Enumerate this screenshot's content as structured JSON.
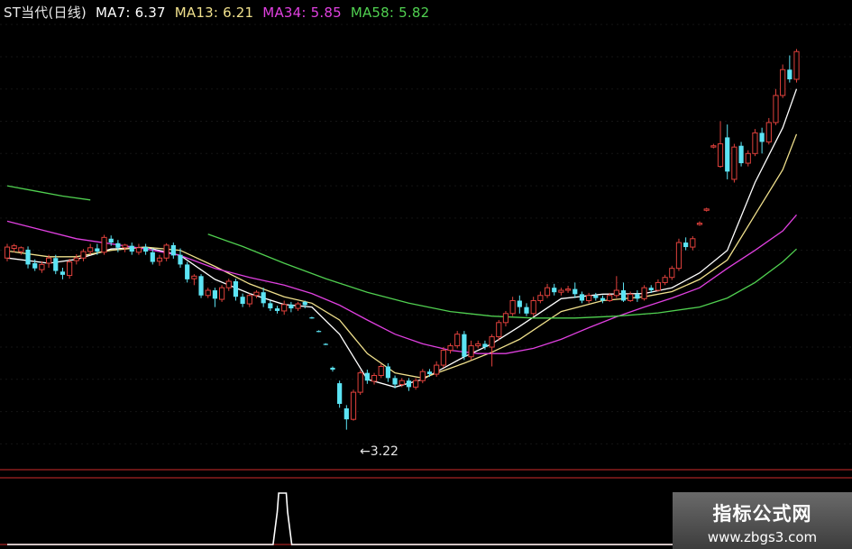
{
  "header": {
    "stock_label": "ST当代(日线)",
    "ma7_text": "MA7: 6.37",
    "ma13_text": "MA13: 6.21",
    "ma34_text": "MA34: 5.85",
    "ma58_text": "MA58: 5.82"
  },
  "annotation": {
    "low_label": "←3.22"
  },
  "watermark": {
    "title": "指标公式网",
    "url": "www.zbgs3.com"
  },
  "colors": {
    "background": "#000000",
    "up": "#e0413c",
    "down": "#5ce4f4",
    "ma7": "#ffffff",
    "ma13": "#f0e08c",
    "ma34": "#e040e0",
    "ma58": "#50d050",
    "axis": "#8b1d1d",
    "indicator": "#ffffff"
  },
  "chart_data": [
    {
      "type": "candlestick",
      "title": "ST当代(日线)",
      "ylim": [
        2.6,
        9.6
      ],
      "low_marker": 3.22,
      "candles": [
        [
          5.88,
          6.05,
          6.1,
          5.83
        ],
        [
          6.03,
          6.07,
          6.1,
          5.97
        ],
        [
          5.98,
          6.04,
          6.06,
          5.93
        ],
        [
          6.01,
          5.78,
          6.06,
          5.72
        ],
        [
          5.8,
          5.72,
          5.86,
          5.68
        ],
        [
          5.7,
          5.78,
          5.83,
          5.65
        ],
        [
          5.8,
          5.88,
          5.93,
          5.73
        ],
        [
          5.88,
          5.68,
          5.93,
          5.63
        ],
        [
          5.67,
          5.62,
          5.73,
          5.55
        ],
        [
          5.61,
          5.82,
          5.87,
          5.56
        ],
        [
          5.84,
          5.88,
          5.94,
          5.78
        ],
        [
          5.88,
          5.98,
          6.02,
          5.83
        ],
        [
          5.98,
          6.04,
          6.1,
          5.93
        ],
        [
          6.03,
          5.98,
          6.1,
          5.93
        ],
        [
          5.97,
          6.2,
          6.24,
          5.93
        ],
        [
          6.18,
          6.12,
          6.23,
          6.07
        ],
        [
          6.11,
          6.04,
          6.16,
          5.97
        ],
        [
          6.04,
          6.08,
          6.1,
          5.97
        ],
        [
          6.07,
          5.98,
          6.12,
          5.93
        ],
        [
          5.97,
          6.04,
          6.1,
          5.93
        ],
        [
          6.05,
          5.98,
          6.1,
          5.93
        ],
        [
          5.97,
          5.82,
          6.03,
          5.78
        ],
        [
          5.83,
          5.88,
          5.93,
          5.76
        ],
        [
          5.88,
          6.08,
          6.11,
          5.83
        ],
        [
          6.08,
          5.92,
          6.12,
          5.87
        ],
        [
          5.93,
          5.78,
          6.03,
          5.73
        ],
        [
          5.78,
          5.55,
          5.82,
          5.5
        ],
        [
          5.56,
          5.6,
          5.63,
          5.46
        ],
        [
          5.6,
          5.3,
          5.63,
          5.26
        ],
        [
          5.3,
          5.38,
          5.42,
          5.26
        ],
        [
          5.38,
          5.25,
          5.42,
          5.12
        ],
        [
          5.24,
          5.42,
          5.46,
          5.2
        ],
        [
          5.42,
          5.52,
          5.56,
          5.37
        ],
        [
          5.52,
          5.28,
          5.56,
          5.22
        ],
        [
          5.28,
          5.17,
          5.33,
          5.12
        ],
        [
          5.17,
          5.3,
          5.33,
          5.12
        ],
        [
          5.3,
          5.35,
          5.38,
          5.26
        ],
        [
          5.35,
          5.18,
          5.42,
          5.12
        ],
        [
          5.18,
          5.1,
          5.22,
          5.06
        ],
        [
          5.1,
          5.06,
          5.14,
          5.02
        ],
        [
          5.06,
          5.16,
          5.22,
          5.0
        ],
        [
          5.16,
          5.1,
          5.2,
          5.04
        ],
        [
          5.1,
          5.17,
          5.2,
          5.06
        ],
        [
          5.2,
          5.15,
          5.22,
          5.1
        ],
        [
          4.96,
          4.95,
          4.97,
          4.94
        ],
        [
          4.75,
          4.74,
          4.76,
          4.73
        ],
        [
          4.55,
          4.54,
          4.56,
          4.53
        ],
        [
          4.18,
          4.15,
          4.2,
          4.12
        ],
        [
          3.94,
          3.62,
          3.98,
          3.56
        ],
        [
          3.55,
          3.38,
          3.6,
          3.22
        ],
        [
          3.38,
          3.8,
          3.84,
          3.36
        ],
        [
          3.8,
          4.1,
          4.14,
          3.76
        ],
        [
          4.1,
          3.98,
          4.15,
          3.93
        ],
        [
          3.97,
          4.06,
          4.1,
          3.92
        ],
        [
          4.06,
          4.2,
          4.24,
          4.02
        ],
        [
          4.2,
          4.02,
          4.25,
          3.96
        ],
        [
          4.02,
          3.92,
          4.06,
          3.86
        ],
        [
          3.92,
          3.98,
          4.02,
          3.88
        ],
        [
          3.98,
          3.88,
          4.02,
          3.82
        ],
        [
          3.88,
          3.98,
          4.02,
          3.84
        ],
        [
          3.98,
          4.12,
          4.16,
          3.94
        ],
        [
          4.12,
          4.08,
          4.16,
          4.04
        ],
        [
          4.08,
          4.22,
          4.28,
          4.04
        ],
        [
          4.22,
          4.45,
          4.5,
          4.18
        ],
        [
          4.45,
          4.52,
          4.56,
          4.4
        ],
        [
          4.52,
          4.7,
          4.75,
          4.48
        ],
        [
          4.7,
          4.35,
          4.75,
          4.3
        ],
        [
          4.35,
          4.52,
          4.6,
          4.3
        ],
        [
          4.52,
          4.55,
          4.6,
          4.48
        ],
        [
          4.55,
          4.5,
          4.6,
          4.46
        ],
        [
          4.5,
          4.66,
          4.7,
          4.2
        ],
        [
          4.66,
          4.88,
          4.92,
          4.6
        ],
        [
          4.88,
          5.02,
          5.06,
          4.82
        ],
        [
          5.02,
          5.22,
          5.28,
          4.98
        ],
        [
          5.22,
          5.12,
          5.3,
          5.02
        ],
        [
          5.12,
          5.02,
          5.18,
          4.98
        ],
        [
          5.02,
          5.22,
          5.28,
          4.98
        ],
        [
          5.22,
          5.3,
          5.36,
          5.18
        ],
        [
          5.3,
          5.42,
          5.48,
          5.26
        ],
        [
          5.42,
          5.35,
          5.48,
          5.3
        ],
        [
          5.35,
          5.38,
          5.42,
          5.3
        ],
        [
          5.38,
          5.4,
          5.45,
          5.34
        ],
        [
          5.4,
          5.32,
          5.5,
          5.26
        ],
        [
          5.32,
          5.22,
          5.36,
          5.18
        ],
        [
          5.22,
          5.3,
          5.34,
          5.18
        ],
        [
          5.3,
          5.26,
          5.34,
          5.22
        ],
        [
          5.26,
          5.22,
          5.3,
          5.18
        ],
        [
          5.22,
          5.3,
          5.34,
          5.2
        ],
        [
          5.3,
          5.38,
          5.6,
          5.26
        ],
        [
          5.38,
          5.22,
          5.5,
          5.2
        ],
        [
          5.22,
          5.32,
          5.36,
          5.2
        ],
        [
          5.32,
          5.25,
          5.38,
          5.2
        ],
        [
          5.25,
          5.42,
          5.46,
          5.22
        ],
        [
          5.42,
          5.38,
          5.46,
          5.34
        ],
        [
          5.38,
          5.5,
          5.55,
          5.36
        ],
        [
          5.5,
          5.58,
          5.62,
          5.46
        ],
        [
          5.58,
          5.72,
          5.76,
          5.54
        ],
        [
          5.72,
          6.12,
          6.18,
          5.68
        ],
        [
          6.12,
          6.05,
          6.2,
          6.0
        ],
        [
          6.05,
          6.18,
          6.22,
          6.0
        ],
        [
          6.4,
          6.42,
          6.45,
          6.38
        ],
        [
          6.62,
          6.64,
          6.66,
          6.6
        ],
        [
          7.6,
          7.62,
          7.65,
          7.58
        ],
        [
          7.3,
          7.65,
          8.0,
          7.28
        ],
        [
          7.75,
          7.22,
          7.95,
          7.1
        ],
        [
          7.1,
          7.6,
          7.65,
          7.05
        ],
        [
          7.62,
          7.35,
          7.68,
          7.3
        ],
        [
          7.35,
          7.5,
          7.55,
          7.3
        ],
        [
          7.5,
          7.82,
          7.88,
          7.46
        ],
        [
          7.82,
          7.68,
          7.9,
          7.5
        ],
        [
          7.68,
          7.98,
          8.05,
          7.64
        ],
        [
          7.98,
          8.4,
          8.5,
          7.94
        ],
        [
          8.4,
          8.8,
          8.88,
          8.36
        ],
        [
          8.8,
          8.65,
          9.02,
          8.6
        ],
        [
          8.65,
          9.08,
          9.12,
          8.6
        ]
      ]
    },
    {
      "type": "line",
      "title": "ST当代(日线)",
      "ylim": [
        2.6,
        9.6
      ],
      "series": [
        {
          "name": "MA7",
          "color": "#ffffff",
          "x": [
            0,
            6,
            10,
            15,
            20,
            25,
            30,
            35,
            40,
            44,
            48,
            52,
            56,
            60,
            66,
            70,
            74,
            80,
            86,
            92,
            96,
            100,
            104,
            108,
            112,
            114
          ],
          "values": [
            5.88,
            5.8,
            5.86,
            6.02,
            6.05,
            5.92,
            5.55,
            5.33,
            5.16,
            5.12,
            4.7,
            4.0,
            3.88,
            4.0,
            4.35,
            4.55,
            4.82,
            5.25,
            5.32,
            5.33,
            5.42,
            5.65,
            6.0,
            7.05,
            7.9,
            8.5
          ]
        },
        {
          "name": "MA13",
          "color": "#f0e08c",
          "x": [
            0,
            6,
            10,
            15,
            20,
            25,
            30,
            35,
            40,
            44,
            48,
            52,
            56,
            60,
            66,
            70,
            74,
            80,
            86,
            92,
            96,
            100,
            104,
            108,
            112,
            114
          ],
          "values": [
            5.99,
            5.9,
            5.9,
            6.0,
            6.05,
            6.0,
            5.75,
            5.48,
            5.28,
            5.18,
            4.92,
            4.4,
            4.1,
            4.02,
            4.25,
            4.42,
            4.62,
            5.05,
            5.22,
            5.28,
            5.36,
            5.55,
            5.85,
            6.55,
            7.25,
            7.8
          ]
        },
        {
          "name": "MA34",
          "color": "#e040e0",
          "x": [
            0,
            10,
            20,
            25,
            30,
            35,
            40,
            44,
            48,
            52,
            56,
            60,
            64,
            68,
            72,
            76,
            80,
            84,
            88,
            92,
            96,
            100,
            104,
            108,
            112,
            114
          ],
          "values": [
            6.45,
            6.18,
            6.02,
            5.92,
            5.72,
            5.58,
            5.46,
            5.33,
            5.15,
            4.92,
            4.7,
            4.55,
            4.45,
            4.4,
            4.4,
            4.48,
            4.62,
            4.8,
            4.97,
            5.12,
            5.26,
            5.42,
            5.72,
            6.0,
            6.3,
            6.55
          ]
        },
        {
          "name": "MA58",
          "color": "#50d050",
          "x": [
            0,
            4,
            8,
            12
          ],
          "values": [
            7.0,
            6.92,
            6.84,
            6.78
          ]
        },
        {
          "name": "MA58",
          "color": "#50d050",
          "x": [
            29,
            34,
            40,
            46,
            52,
            58,
            64,
            70,
            76,
            82,
            88,
            94,
            100,
            104,
            108,
            112,
            114
          ],
          "values": [
            6.25,
            6.06,
            5.8,
            5.56,
            5.35,
            5.18,
            5.05,
            4.98,
            4.95,
            4.95,
            4.98,
            5.03,
            5.12,
            5.26,
            5.5,
            5.82,
            6.02
          ]
        }
      ]
    },
    {
      "type": "line",
      "ylim": [
        0,
        1
      ],
      "series": [
        {
          "name": "",
          "color": "#ffffff",
          "x": [
            0,
            38.4,
            39.0,
            39.2,
            40.3,
            40.5,
            41.1,
            114
          ],
          "values": [
            0,
            0,
            0.6,
            0.95,
            0.95,
            0.6,
            0,
            0
          ]
        }
      ]
    }
  ]
}
